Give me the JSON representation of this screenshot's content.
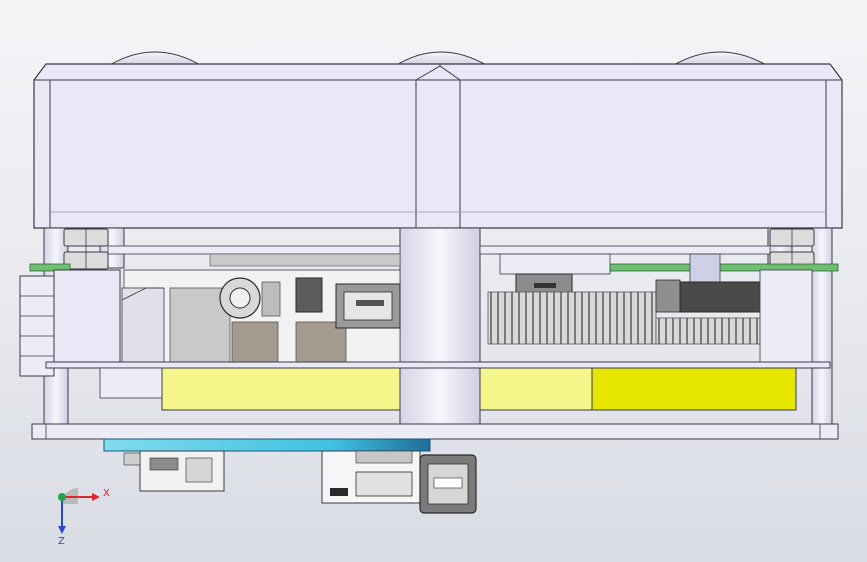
{
  "viewport": {
    "background_top": "#f4f5f7",
    "background_bottom": "#d9dce3"
  },
  "colors": {
    "enclosure": "#e8e8f6",
    "enclosure_edge": "#3a3a4a",
    "board_green": "#6fbf73",
    "battery_yellow": "#f5f58a",
    "battery_yellow_bright": "#e6e600",
    "base_plate_cyan": "#3fc2e0",
    "connector_grey": "#8c8c8c",
    "heatsink_grey": "#bdbdbd",
    "axis_x": "#e0262a",
    "axis_y": "#21a34a",
    "axis_z": "#2c49c9"
  },
  "triad": {
    "x_label": "X",
    "z_label": "Z",
    "icon": "coordinate-triad-icon"
  }
}
